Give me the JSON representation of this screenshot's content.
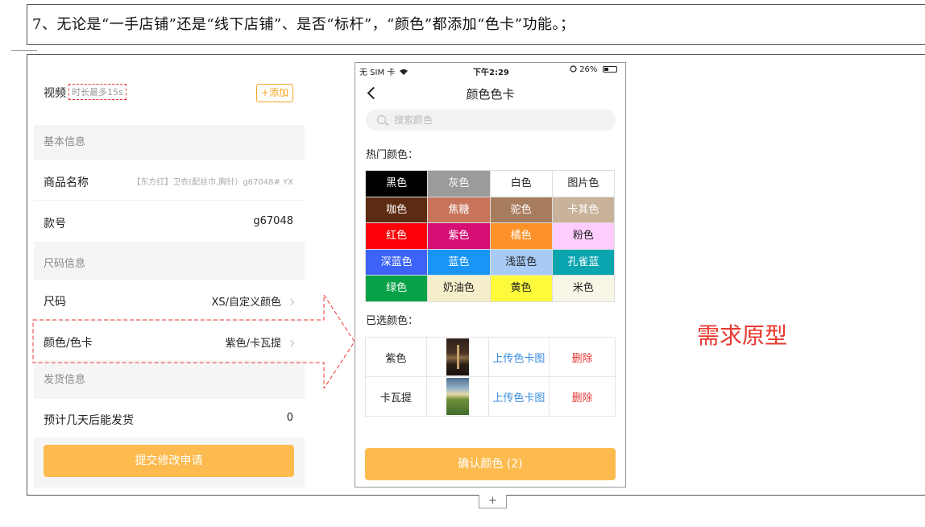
{
  "note": "7、无论是“一手店铺”还是“线下店铺”、是否“标杆”，“颜色”都添加“色卡”功能。；",
  "form": {
    "video_label": "视频",
    "video_hint": "时长最多15s",
    "add_button": "+添加",
    "basic_section": "基本信息",
    "product_name_label": "商品名称",
    "product_name_value": "【东方红】卫衣(配丝巾,胸针）g67048# YX",
    "style_no_label": "款号",
    "style_no_value": "g67048",
    "size_section": "尺码信息",
    "size_label": "尺码",
    "size_value": "XS/自定义颜色",
    "color_label": "颜色/色卡",
    "color_value": "紫色/卡瓦提",
    "ship_section": "发货信息",
    "ship_days_label": "预计几天后能发货",
    "ship_days_value": "0",
    "submit_button": "提交修改申请"
  },
  "phone": {
    "status": {
      "carrier": "无 SIM 卡",
      "time": "下午2:29",
      "battery": "26%"
    },
    "title": "颜色色卡",
    "search_placeholder": "搜索颜色",
    "hot_title": "热门颜色：",
    "colors": [
      {
        "name": "黑色",
        "bg": "#000000",
        "fg": "#ffffff"
      },
      {
        "name": "灰色",
        "bg": "#9b9b9b",
        "fg": "#ffffff"
      },
      {
        "name": "白色",
        "bg": "#ffffff",
        "fg": "#222222"
      },
      {
        "name": "图片色",
        "bg": "#ffffff",
        "fg": "#222222"
      },
      {
        "name": "咖色",
        "bg": "#5d2a12",
        "fg": "#ffffff"
      },
      {
        "name": "焦糖",
        "bg": "#c8745a",
        "fg": "#ffffff"
      },
      {
        "name": "驼色",
        "bg": "#a87d5e",
        "fg": "#ffffff"
      },
      {
        "name": "卡其色",
        "bg": "#c8b29a",
        "fg": "#ffffff"
      },
      {
        "name": "红色",
        "bg": "#fb0007",
        "fg": "#ffffff"
      },
      {
        "name": "紫色",
        "bg": "#d60f75",
        "fg": "#ffffff"
      },
      {
        "name": "橘色",
        "bg": "#fd922b",
        "fg": "#ffffff"
      },
      {
        "name": "粉色",
        "bg": "#fecdfd",
        "fg": "#222222"
      },
      {
        "name": "深蓝色",
        "bg": "#3c63f6",
        "fg": "#ffffff"
      },
      {
        "name": "蓝色",
        "bg": "#1895f5",
        "fg": "#ffffff"
      },
      {
        "name": "浅蓝色",
        "bg": "#a8cbf6",
        "fg": "#222222"
      },
      {
        "name": "孔雀蓝",
        "bg": "#0aa5af",
        "fg": "#ffffff"
      },
      {
        "name": "绿色",
        "bg": "#07a147",
        "fg": "#ffffff"
      },
      {
        "name": "奶油色",
        "bg": "#f5efcb",
        "fg": "#222222"
      },
      {
        "name": "黄色",
        "bg": "#fcfa3a",
        "fg": "#222222"
      },
      {
        "name": "米色",
        "bg": "#f7f6e7",
        "fg": "#222222"
      }
    ],
    "selected_title": "已选颜色：",
    "selected": [
      {
        "name": "紫色",
        "image": "night-photo",
        "upload": "上传色卡图",
        "delete": "删除"
      },
      {
        "name": "卡瓦提",
        "image": "landscape-photo",
        "upload": "上传色卡图",
        "delete": "删除"
      }
    ],
    "confirm_button": "确认颜色 (2)"
  },
  "prototype_label": "需求原型",
  "add_row_button": "+"
}
